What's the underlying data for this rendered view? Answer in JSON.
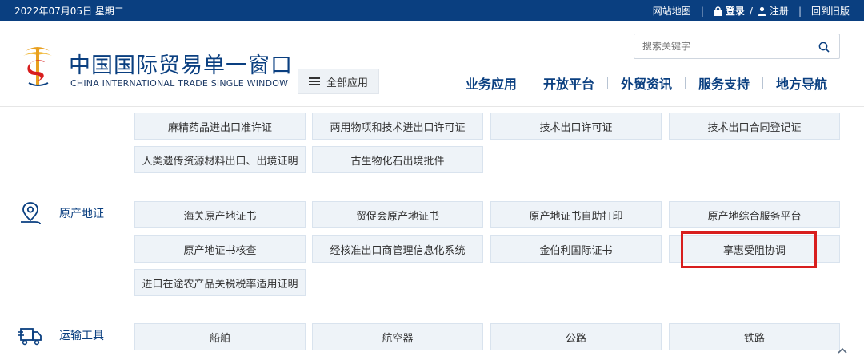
{
  "topbar": {
    "date": "2022年07月05日 星期二",
    "sitemap": "网站地图",
    "login": "登录",
    "slash": "/",
    "register": "注册",
    "old_version": "回到旧版",
    "divider": "|"
  },
  "header": {
    "title": "中国国际贸易单一窗口",
    "subtitle": "CHINA INTERNATIONAL TRADE SINGLE WINDOW",
    "all_apps": "全部应用",
    "search_placeholder": "搜索关键字",
    "nav": [
      "业务应用",
      "开放平台",
      "外贸资讯",
      "服务支持",
      "地方导航"
    ]
  },
  "sections": {
    "top_rows": {
      "row1": [
        "麻精药品进出口准许证",
        "两用物项和技术进出口许可证",
        "技术出口许可证",
        "技术出口合同登记证"
      ],
      "row2": [
        "人类遗传资源材料出口、出境证明",
        "古生物化石出境批件"
      ]
    },
    "origin": {
      "label": "原产地证",
      "row1": [
        "海关原产地证书",
        "贸促会原产地证书",
        "原产地证书自助打印",
        "原产地综合服务平台"
      ],
      "row2": [
        "原产地证书核查",
        "经核准出口商管理信息化系统",
        "金伯利国际证书",
        "享惠受阻协调"
      ],
      "row3": [
        "进口在途农产品关税税率适用证明"
      ]
    },
    "transport": {
      "label": "运输工具",
      "row1": [
        "船舶",
        "航空器",
        "公路",
        "铁路"
      ]
    }
  },
  "colors": {
    "brand": "#0a3f80",
    "button_bg": "#eef3f8",
    "highlight": "#d81e1e"
  },
  "icons": [
    "lock-icon",
    "user-icon",
    "logo-emblem",
    "menu-icon",
    "search-icon",
    "location-pin-icon",
    "truck-icon",
    "chevron-up-icon"
  ]
}
